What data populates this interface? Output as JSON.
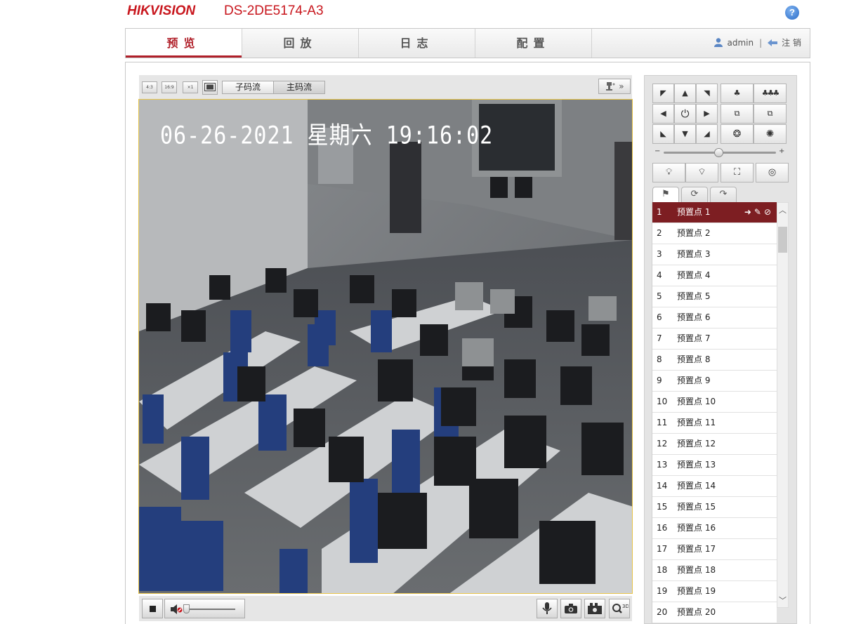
{
  "brand": {
    "logo": "HIKVISION",
    "model": "DS-2DE5174-A3",
    "help_label": "?"
  },
  "nav": {
    "tabs": [
      {
        "label": "预览",
        "active": true
      },
      {
        "label": "回放",
        "active": false
      },
      {
        "label": "日志",
        "active": false
      },
      {
        "label": "配置",
        "active": false
      }
    ],
    "user": "admin",
    "logout": "注 销"
  },
  "toolbar": {
    "ratio_buttons": [
      "4:3",
      "16:9",
      "×1",
      "fit"
    ],
    "substream": "子码流",
    "mainstream": "主码流",
    "mainstream_active": true
  },
  "video": {
    "osd": "06-26-2021 星期六 19:16:02"
  },
  "ptz": {
    "presets": [
      {
        "n": "1",
        "label": "预置点 1"
      },
      {
        "n": "2",
        "label": "预置点 2"
      },
      {
        "n": "3",
        "label": "预置点 3"
      },
      {
        "n": "4",
        "label": "预置点 4"
      },
      {
        "n": "5",
        "label": "预置点 5"
      },
      {
        "n": "6",
        "label": "预置点 6"
      },
      {
        "n": "7",
        "label": "预置点 7"
      },
      {
        "n": "8",
        "label": "预置点 8"
      },
      {
        "n": "9",
        "label": "预置点 9"
      },
      {
        "n": "10",
        "label": "预置点 10"
      },
      {
        "n": "11",
        "label": "预置点 11"
      },
      {
        "n": "12",
        "label": "预置点 12"
      },
      {
        "n": "13",
        "label": "预置点 13"
      },
      {
        "n": "14",
        "label": "预置点 14"
      },
      {
        "n": "15",
        "label": "预置点 15"
      },
      {
        "n": "16",
        "label": "预置点 16"
      },
      {
        "n": "17",
        "label": "预置点 17"
      },
      {
        "n": "18",
        "label": "预置点 18"
      },
      {
        "n": "19",
        "label": "预置点 19"
      },
      {
        "n": "20",
        "label": "预置点 20"
      }
    ],
    "selected_index": 0
  },
  "colors": {
    "brand_red": "#c8161d",
    "selected_row": "#7d1e22",
    "video_border": "#e8c54a"
  }
}
